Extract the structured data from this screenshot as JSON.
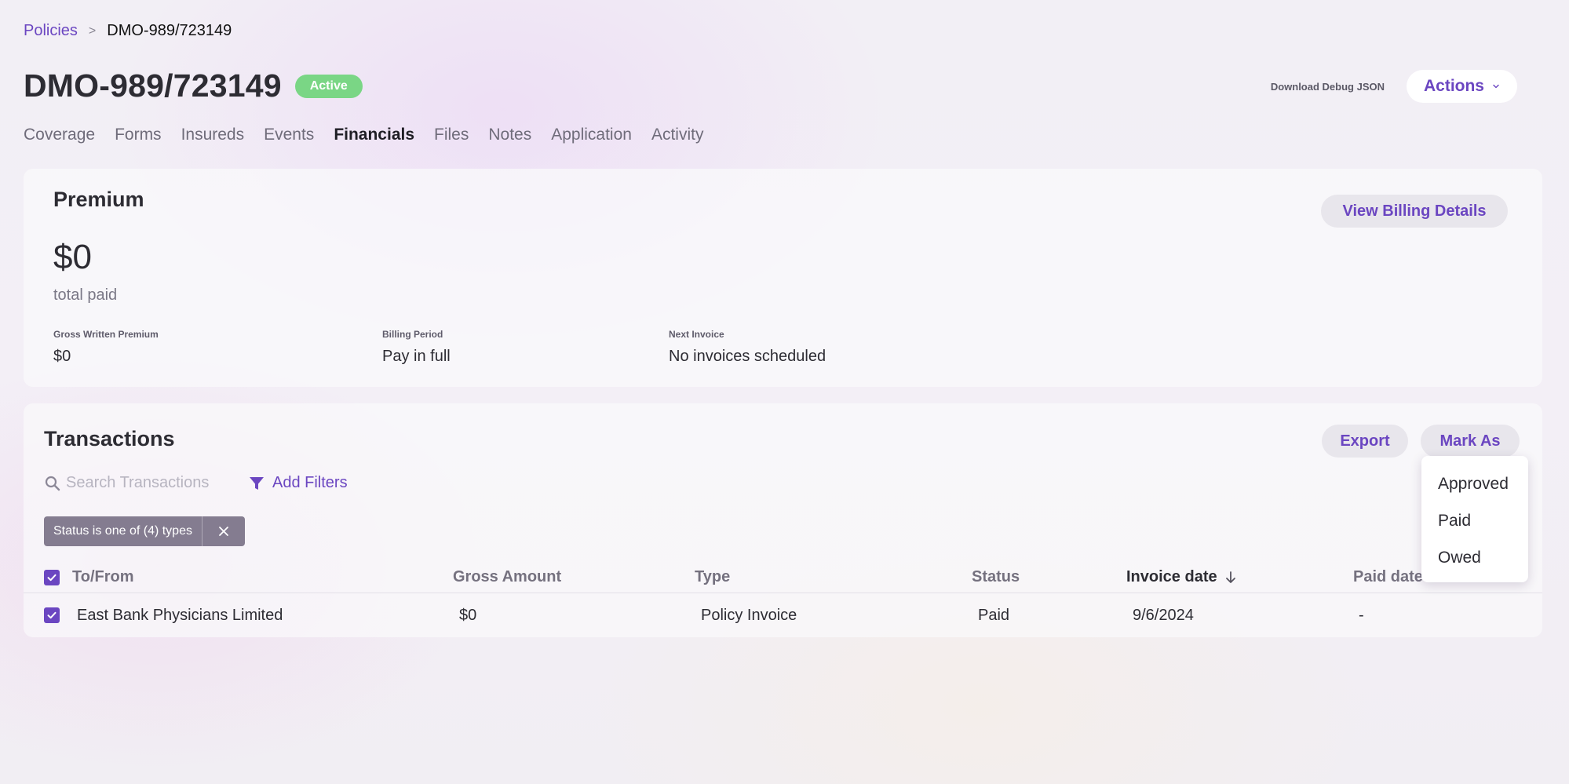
{
  "breadcrumb": {
    "parent": "Policies",
    "separator": ">",
    "current": "DMO-989/723149"
  },
  "header": {
    "title": "DMO-989/723149",
    "status": "Active",
    "debug_link": "Download Debug JSON",
    "actions_label": "Actions"
  },
  "tabs": [
    {
      "label": "Coverage"
    },
    {
      "label": "Forms"
    },
    {
      "label": "Insureds"
    },
    {
      "label": "Events"
    },
    {
      "label": "Financials",
      "active": true
    },
    {
      "label": "Files"
    },
    {
      "label": "Notes"
    },
    {
      "label": "Application"
    },
    {
      "label": "Activity"
    }
  ],
  "premium": {
    "title": "Premium",
    "amount": "$0",
    "caption": "total paid",
    "view_billing_label": "View Billing Details",
    "gross_written_premium": {
      "label": "Gross Written Premium",
      "value": "$0"
    },
    "billing_period": {
      "label": "Billing Period",
      "value": "Pay in full"
    },
    "next_invoice": {
      "label": "Next Invoice",
      "value": "No invoices scheduled"
    }
  },
  "transactions": {
    "title": "Transactions",
    "export_label": "Export",
    "mark_as_label": "Mark As",
    "search_placeholder": "Search Transactions",
    "add_filters_label": "Add Filters",
    "filter_chip": "Status is one of (4) types",
    "columns": {
      "to_from": "To/From",
      "gross_amount": "Gross Amount",
      "type": "Type",
      "status": "Status",
      "invoice_date": "Invoice date",
      "paid_date": "Paid date"
    },
    "rows": [
      {
        "to_from": "East Bank Physicians Limited",
        "gross_amount": "$0",
        "type": "Policy Invoice",
        "status": "Paid",
        "invoice_date": "9/6/2024",
        "paid_date": "-",
        "checked": true
      }
    ]
  },
  "mark_as_menu": {
    "items": [
      "Approved",
      "Paid",
      "Owed"
    ]
  },
  "colors": {
    "accent": "#6b46c1",
    "status_active": "#7ad685",
    "chip_bg": "#847c90"
  },
  "icons": {
    "search": "search-icon",
    "filter": "filter-icon",
    "close": "close-icon",
    "chevron": "chevron-down-icon",
    "sort": "arrow-down-icon",
    "check": "check-icon"
  }
}
